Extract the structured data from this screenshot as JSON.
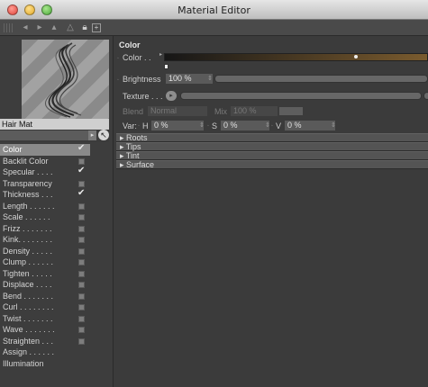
{
  "window": {
    "title": "Material Editor"
  },
  "material": {
    "name": "Hair Mat"
  },
  "channels": [
    {
      "label": "Color",
      "checked": true,
      "active": true
    },
    {
      "label": "Backlit Color",
      "checked": false
    },
    {
      "label": "Specular . . . .",
      "checked": true
    },
    {
      "label": "Transparency",
      "checked": false
    },
    {
      "label": "Thickness . . .",
      "checked": true
    },
    {
      "label": "Length . . . . . .",
      "checked": false
    },
    {
      "label": "Scale . . . . . .",
      "checked": false
    },
    {
      "label": "Frizz . . . . . . .",
      "checked": false
    },
    {
      "label": "Kink. . . . . . . .",
      "checked": false
    },
    {
      "label": "Density . . . . .",
      "checked": false
    },
    {
      "label": "Clump . . . . . .",
      "checked": false
    },
    {
      "label": "Tighten . . . . .",
      "checked": false
    },
    {
      "label": "Displace . . . .",
      "checked": false
    },
    {
      "label": "Bend . . . . . . .",
      "checked": false
    },
    {
      "label": "Curl . . . . . . . .",
      "checked": false
    },
    {
      "label": "Twist . . . . . . .",
      "checked": false
    },
    {
      "label": "Wave . . . . . . .",
      "checked": false
    },
    {
      "label": "Straighten . . .",
      "checked": false
    },
    {
      "label": "Assign . . . . . .",
      "checked": null
    },
    {
      "label": "Illumination",
      "checked": null
    }
  ],
  "color_section": {
    "title": "Color",
    "color_label": "Color . .",
    "brightness_label": "Brightness",
    "brightness_value": "100 %",
    "texture_label": "Texture . . .",
    "blend_label": "Blend",
    "blend_value": "Normal",
    "mix_label": "Mix",
    "mix_value": "100 %",
    "var_label": "Var:",
    "h_label": "H",
    "h_value": "0 %",
    "s_label": "S",
    "s_value": "0 %",
    "v_label": "V",
    "v_value": "0 %"
  },
  "folds": [
    "Roots",
    "Tips",
    "Tint",
    "Surface"
  ],
  "colors": {
    "gradient_start": "#161616",
    "gradient_end": "#7a5b2e",
    "active_channel": "#8a8a8a"
  }
}
